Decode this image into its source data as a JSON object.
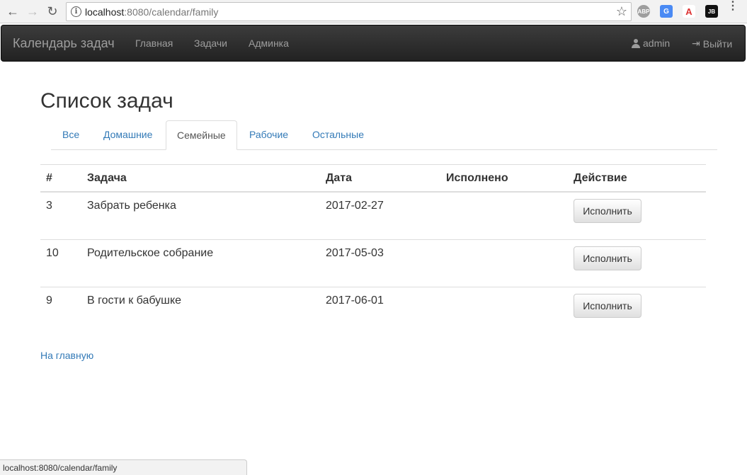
{
  "browser": {
    "url_host": "localhost",
    "url_rest": ":8080/calendar/family",
    "status_url": "localhost:8080/calendar/family",
    "extensions": {
      "abp": "ABP",
      "translate": "G",
      "angular": "A",
      "jb": "JB"
    }
  },
  "navbar": {
    "brand": "Календарь задач",
    "links": [
      "Главная",
      "Задачи",
      "Админка"
    ],
    "user": "admin",
    "logout": "Выйти"
  },
  "page": {
    "title": "Список задач",
    "tabs": [
      {
        "label": "Все",
        "active": false
      },
      {
        "label": "Домашние",
        "active": false
      },
      {
        "label": "Семейные",
        "active": true
      },
      {
        "label": "Рабочие",
        "active": false
      },
      {
        "label": "Остальные",
        "active": false
      }
    ],
    "table": {
      "headers": [
        "#",
        "Задача",
        "Дата",
        "Исполнено",
        "Действие"
      ],
      "rows": [
        {
          "id": "3",
          "task": "Забрать ребенка",
          "date": "2017-02-27",
          "done": "",
          "action": "Исполнить"
        },
        {
          "id": "10",
          "task": "Родительское собрание",
          "date": "2017-05-03",
          "done": "",
          "action": "Исполнить"
        },
        {
          "id": "9",
          "task": "В гости к бабушке",
          "date": "2017-06-01",
          "done": "",
          "action": "Исполнить"
        }
      ]
    },
    "home_link": "На главную"
  },
  "colors": {
    "link": "#337ab7",
    "navbar_bg": "#222222",
    "navbar_text": "#9d9d9d"
  }
}
